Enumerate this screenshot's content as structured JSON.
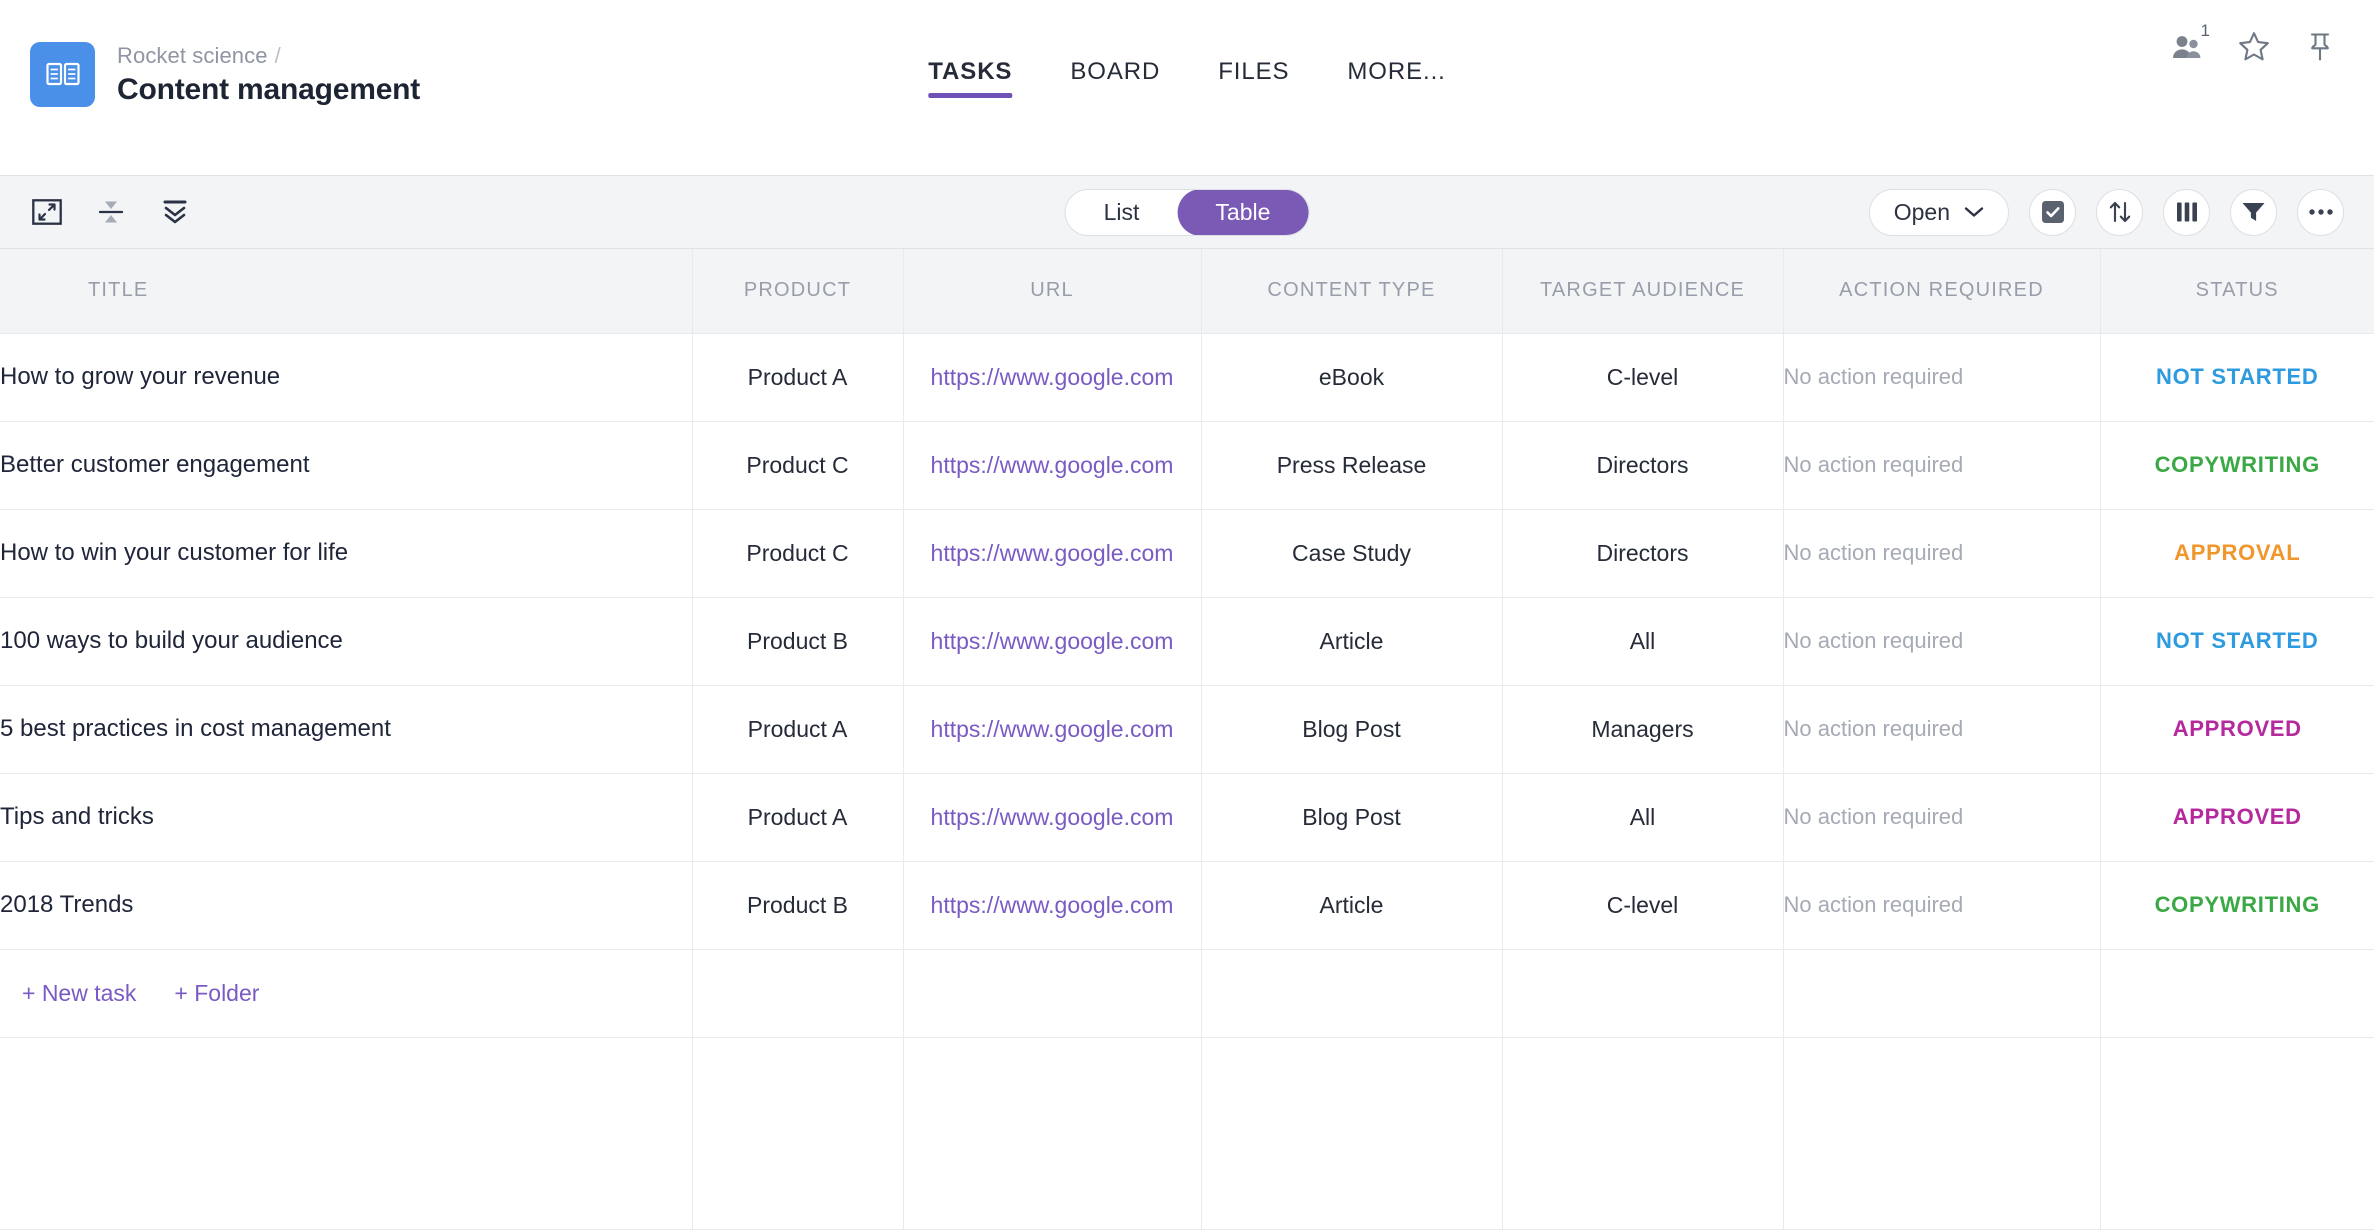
{
  "header": {
    "breadcrumb_parent": "Rocket science",
    "breadcrumb_separator": "/",
    "project_title": "Content management",
    "logo_icon": "book-icon",
    "logo_color": "#4a90e8",
    "tabs": [
      {
        "label": "TASKS",
        "active": true
      },
      {
        "label": "BOARD",
        "active": false
      },
      {
        "label": "FILES",
        "active": false
      },
      {
        "label": "MORE...",
        "active": false
      }
    ],
    "active_tab_underline_color": "#6f52b5",
    "icons": [
      {
        "name": "members-icon",
        "badge": "1"
      },
      {
        "name": "star-icon",
        "badge": ""
      },
      {
        "name": "pin-icon",
        "badge": ""
      }
    ]
  },
  "toolbar": {
    "left_icons": [
      {
        "name": "fullscreen-icon"
      },
      {
        "name": "collapse-all-icon"
      },
      {
        "name": "expand-all-icon"
      }
    ],
    "view_toggle": {
      "options": [
        {
          "label": "List",
          "active": false
        },
        {
          "label": "Table",
          "active": true
        }
      ],
      "active_color": "#7a5ab5"
    },
    "status_filter": {
      "label": "Open",
      "chevron": "chevron-down-icon"
    },
    "right_icons": [
      {
        "name": "checkbox-icon"
      },
      {
        "name": "sort-icon"
      },
      {
        "name": "columns-icon"
      },
      {
        "name": "filter-icon"
      },
      {
        "name": "more-icon"
      }
    ]
  },
  "table": {
    "columns": [
      "TITLE",
      "PRODUCT",
      "URL",
      "CONTENT TYPE",
      "TARGET AUDIENCE",
      "ACTION REQUIRED",
      "STATUS"
    ],
    "status_colors": {
      "NOT STARTED": "#2e9ae0",
      "COPYWRITING": "#3aa845",
      "APPROVAL": "#f0962a",
      "APPROVED": "#b5289e"
    },
    "rows": [
      {
        "title": "How to grow your revenue",
        "product": "Product A",
        "url": "https://www.google.com",
        "content_type": "eBook",
        "target_audience": "C-level",
        "action_required": "No action required",
        "status": "NOT STARTED"
      },
      {
        "title": "Better customer engagement",
        "product": "Product C",
        "url": "https://www.google.com",
        "content_type": "Press Release",
        "target_audience": "Directors",
        "action_required": "No action required",
        "status": "COPYWRITING"
      },
      {
        "title": "How to win your customer for life",
        "product": "Product C",
        "url": "https://www.google.com",
        "content_type": "Case Study",
        "target_audience": "Directors",
        "action_required": "No action required",
        "status": "APPROVAL"
      },
      {
        "title": "100 ways to build your audience",
        "product": "Product B",
        "url": "https://www.google.com",
        "content_type": "Article",
        "target_audience": "All",
        "action_required": "No action required",
        "status": "NOT STARTED"
      },
      {
        "title": "5 best practices in cost management",
        "product": "Product A",
        "url": "https://www.google.com",
        "content_type": "Blog Post",
        "target_audience": "Managers",
        "action_required": "No action required",
        "status": "APPROVED"
      },
      {
        "title": "Tips and tricks",
        "product": "Product A",
        "url": "https://www.google.com",
        "content_type": "Blog Post",
        "target_audience": "All",
        "action_required": "No action required",
        "status": "APPROVED"
      },
      {
        "title": "2018 Trends",
        "product": "Product B",
        "url": "https://www.google.com",
        "content_type": "Article",
        "target_audience": "C-level",
        "action_required": "No action required",
        "status": "COPYWRITING"
      }
    ],
    "footer": {
      "new_task_label": "+ New task",
      "new_folder_label": "+ Folder",
      "link_color": "#7a5ac4"
    }
  }
}
